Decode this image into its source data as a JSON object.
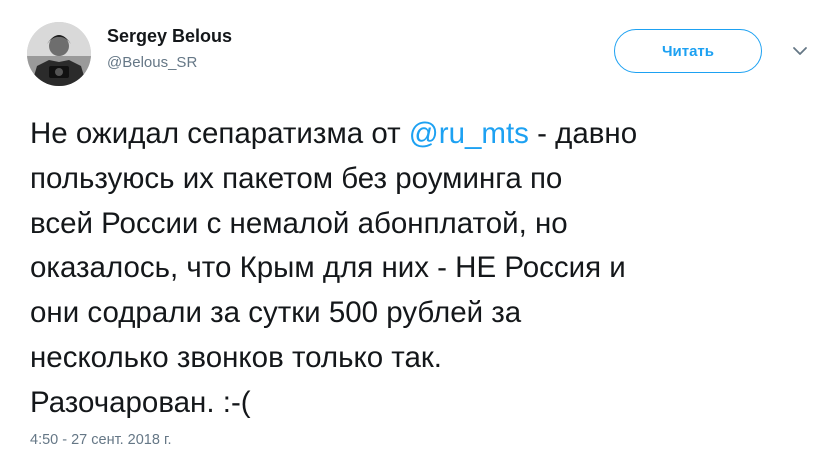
{
  "author": {
    "name": "Sergey Belous",
    "handle": "@Belous_SR"
  },
  "follow_button": {
    "label": "Читать"
  },
  "menu": {
    "icon": "chevron-down-icon"
  },
  "tweet": {
    "lines": [
      {
        "before": "Не ожидал сепаратизма от ",
        "mention": "@ru_mts",
        "after": " - давно"
      },
      {
        "text": "пользуюсь их пакетом без роуминга по"
      },
      {
        "text": "всей России с немалой абонплатой, но"
      },
      {
        "text": "оказалось, что Крым для них - НЕ Россия и"
      },
      {
        "text": "они содрали за сутки 500 рублей за"
      },
      {
        "text": "несколько звонков только так."
      },
      {
        "text": "Разочарован. :-("
      }
    ]
  },
  "timestamp": "4:50 - 27 сент. 2018 г.",
  "colors": {
    "accent": "#1da1f2",
    "secondary_text": "#657786",
    "primary_text": "#14171a"
  }
}
